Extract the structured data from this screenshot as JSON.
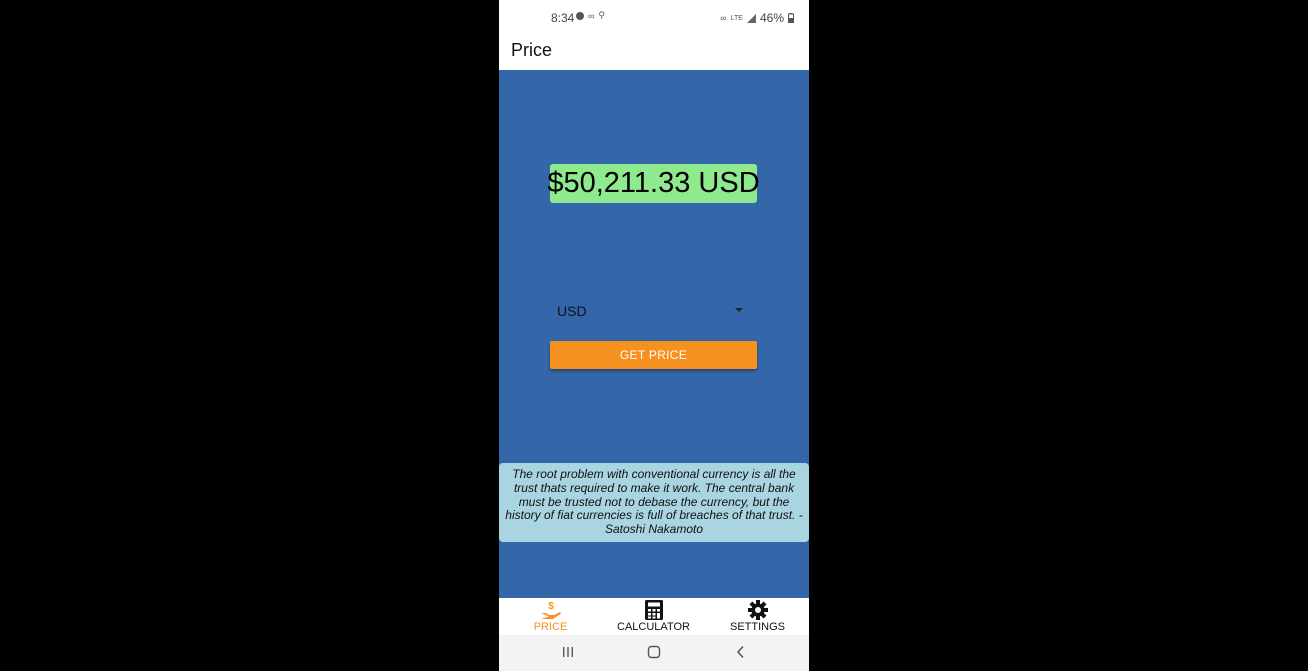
{
  "status_bar": {
    "time": "8:34",
    "battery": "46%",
    "network": "LTE"
  },
  "app_bar": {
    "title": "Price"
  },
  "price": {
    "display": "$50,211.33 USD"
  },
  "currency_select": {
    "selected": "USD"
  },
  "get_price_button": {
    "label": "GET PRICE"
  },
  "quote": {
    "text": "The root problem with conventional currency is all the trust thats required to make it work. The central bank must be trusted not to debase the currency, but the history of fiat currencies is full of breaches of that trust. - Satoshi Nakamoto"
  },
  "bottom_nav": {
    "items": [
      {
        "label": "PRICE",
        "icon": "hand-dollar-icon",
        "active": true
      },
      {
        "label": "CALCULATOR",
        "icon": "calculator-icon",
        "active": false
      },
      {
        "label": "SETTINGS",
        "icon": "gear-icon",
        "active": false
      }
    ]
  },
  "colors": {
    "content_background": "#3466aa",
    "price_background": "#8fe98f",
    "accent": "#f6911f",
    "quote_background": "#a9d4e2"
  }
}
